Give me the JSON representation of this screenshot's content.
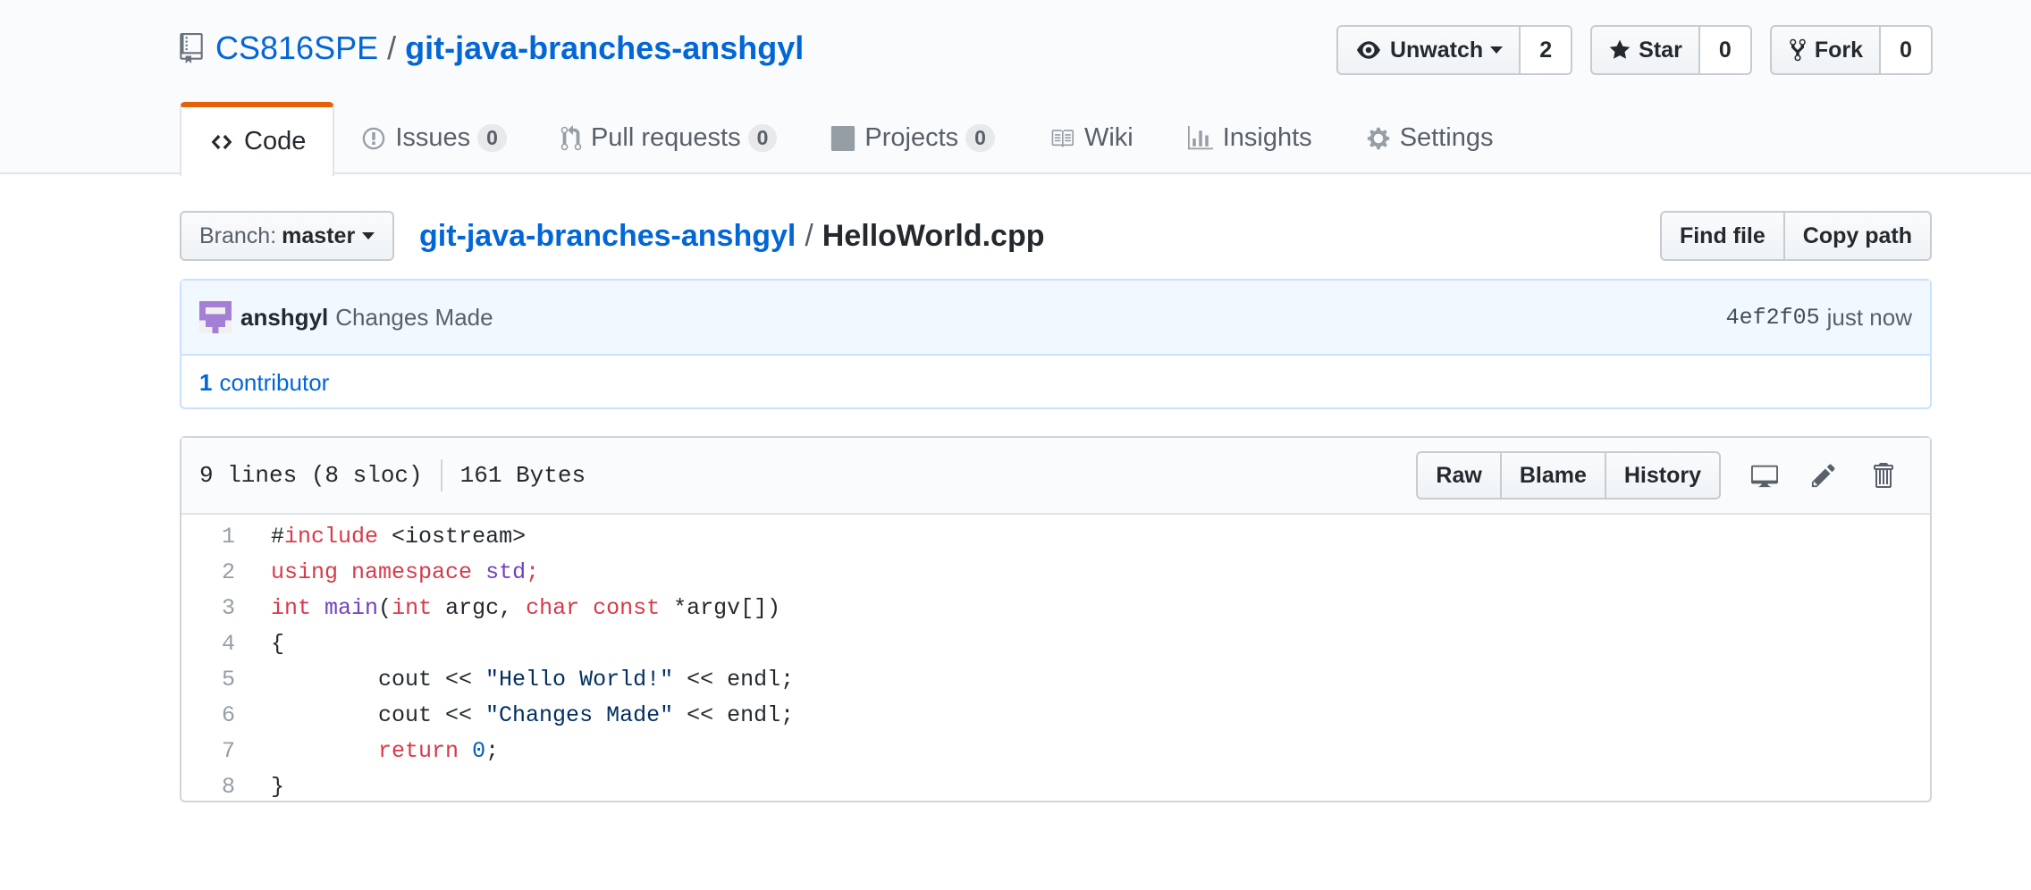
{
  "repo": {
    "owner": "CS816SPE",
    "separator": "/",
    "name": "git-java-branches-anshgyl"
  },
  "actions": {
    "watch": {
      "label": "Unwatch",
      "count": "2"
    },
    "star": {
      "label": "Star",
      "count": "0"
    },
    "fork": {
      "label": "Fork",
      "count": "0"
    }
  },
  "tabs": [
    {
      "label": "Code",
      "counter": null
    },
    {
      "label": "Issues",
      "counter": "0"
    },
    {
      "label": "Pull requests",
      "counter": "0"
    },
    {
      "label": "Projects",
      "counter": "0"
    },
    {
      "label": "Wiki",
      "counter": null
    },
    {
      "label": "Insights",
      "counter": null
    },
    {
      "label": "Settings",
      "counter": null
    }
  ],
  "branch": {
    "label": "Branch:",
    "value": "master"
  },
  "breadcrumb": {
    "root": "git-java-branches-anshgyl",
    "separator": "/",
    "file": "HelloWorld.cpp"
  },
  "file_actions": {
    "find_file": "Find file",
    "copy_path": "Copy path"
  },
  "commit": {
    "author": "anshgyl",
    "message": "Changes Made",
    "sha": "4ef2f05",
    "time": "just now"
  },
  "contributors": {
    "count": "1",
    "label": "contributor"
  },
  "file": {
    "lines_info": "9 lines (8 sloc)",
    "size": "161 Bytes",
    "buttons": {
      "raw": "Raw",
      "blame": "Blame",
      "history": "History"
    }
  },
  "code_lines": [
    {
      "n": "1",
      "text": "#include <iostream>"
    },
    {
      "n": "2",
      "text": "using namespace std;"
    },
    {
      "n": "3",
      "text": "int main(int argc, char const *argv[])"
    },
    {
      "n": "4",
      "text": "{"
    },
    {
      "n": "5",
      "text": "        cout << \"Hello World!\" << endl;"
    },
    {
      "n": "6",
      "text": "        cout << \"Changes Made\" << endl;"
    },
    {
      "n": "7",
      "text": "        return 0;"
    },
    {
      "n": "8",
      "text": "}"
    }
  ],
  "colors": {
    "link": "#0366d6",
    "tab_accent": "#e36209",
    "keyword": "#d73a49",
    "function": "#6f42c1",
    "string": "#032f62",
    "constant": "#005cc5",
    "commit_bg": "#f1f8ff"
  },
  "icons": [
    "repo-icon",
    "eye-icon",
    "star-icon",
    "fork-icon",
    "code-icon",
    "issue-icon",
    "pull-request-icon",
    "project-icon",
    "book-icon",
    "graph-icon",
    "gear-icon",
    "avatar-identicon",
    "desktop-icon",
    "pencil-icon",
    "trash-icon"
  ]
}
